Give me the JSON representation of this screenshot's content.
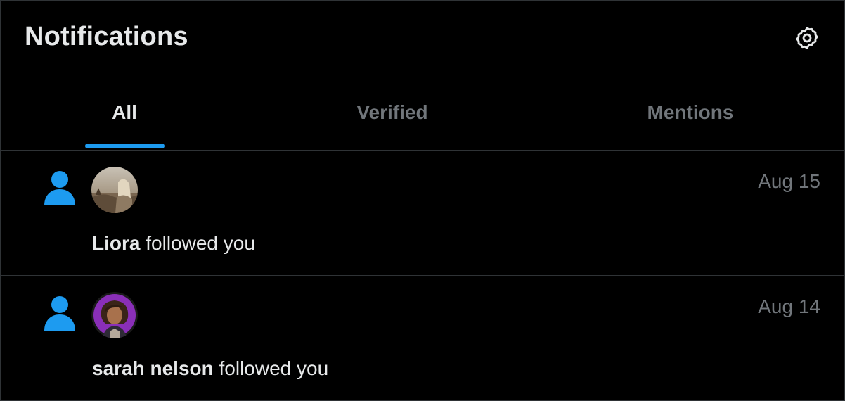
{
  "header": {
    "title": "Notifications",
    "settings_icon": "gear-icon"
  },
  "tabs": [
    {
      "label": "All",
      "active": true
    },
    {
      "label": "Verified",
      "active": false
    },
    {
      "label": "Mentions",
      "active": false
    }
  ],
  "colors": {
    "accent": "#1d9bf0",
    "text_primary": "#e7e9ea",
    "text_secondary": "#71767b",
    "border": "#2f3336",
    "background": "#000000"
  },
  "notifications": [
    {
      "icon": "person-icon",
      "user": "Liora",
      "action": "followed you",
      "date": "Aug 15"
    },
    {
      "icon": "person-icon",
      "user": "sarah nelson",
      "action": "followed you",
      "date": "Aug 14"
    }
  ]
}
